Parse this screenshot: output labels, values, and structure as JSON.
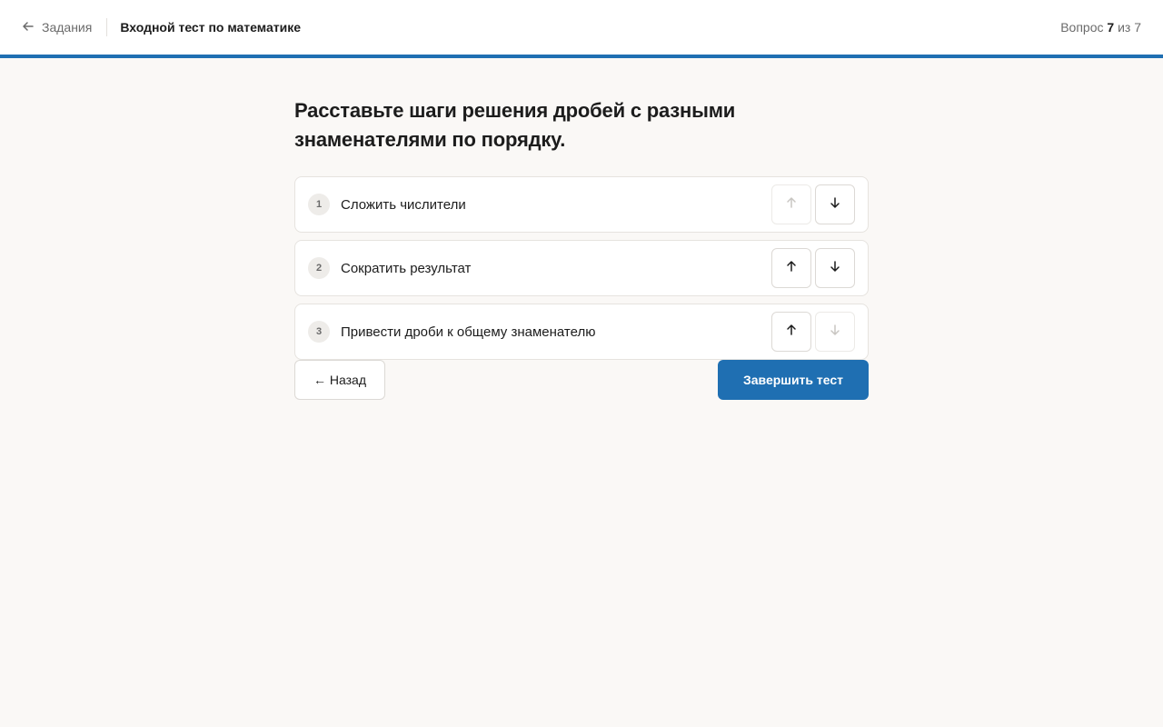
{
  "header": {
    "back_label": "Задания",
    "title": "Входной тест по математике",
    "progress_prefix": "Вопрос",
    "progress_current": "7",
    "progress_sep": "из",
    "progress_total": "7"
  },
  "question": {
    "text": "Расставьте шаги решения дробей с разными знаменателями по порядку."
  },
  "items": [
    {
      "number": "1",
      "label": "Сложить числители",
      "up_enabled": false,
      "down_enabled": true
    },
    {
      "number": "2",
      "label": "Сократить результат",
      "up_enabled": true,
      "down_enabled": true
    },
    {
      "number": "3",
      "label": "Привести дроби к общему знаменателю",
      "up_enabled": true,
      "down_enabled": false
    }
  ],
  "footer": {
    "back_button": "← Назад",
    "finish_button": "Завершить тест"
  },
  "colors": {
    "accent": "#1f6fb2",
    "background": "#faf8f6"
  }
}
